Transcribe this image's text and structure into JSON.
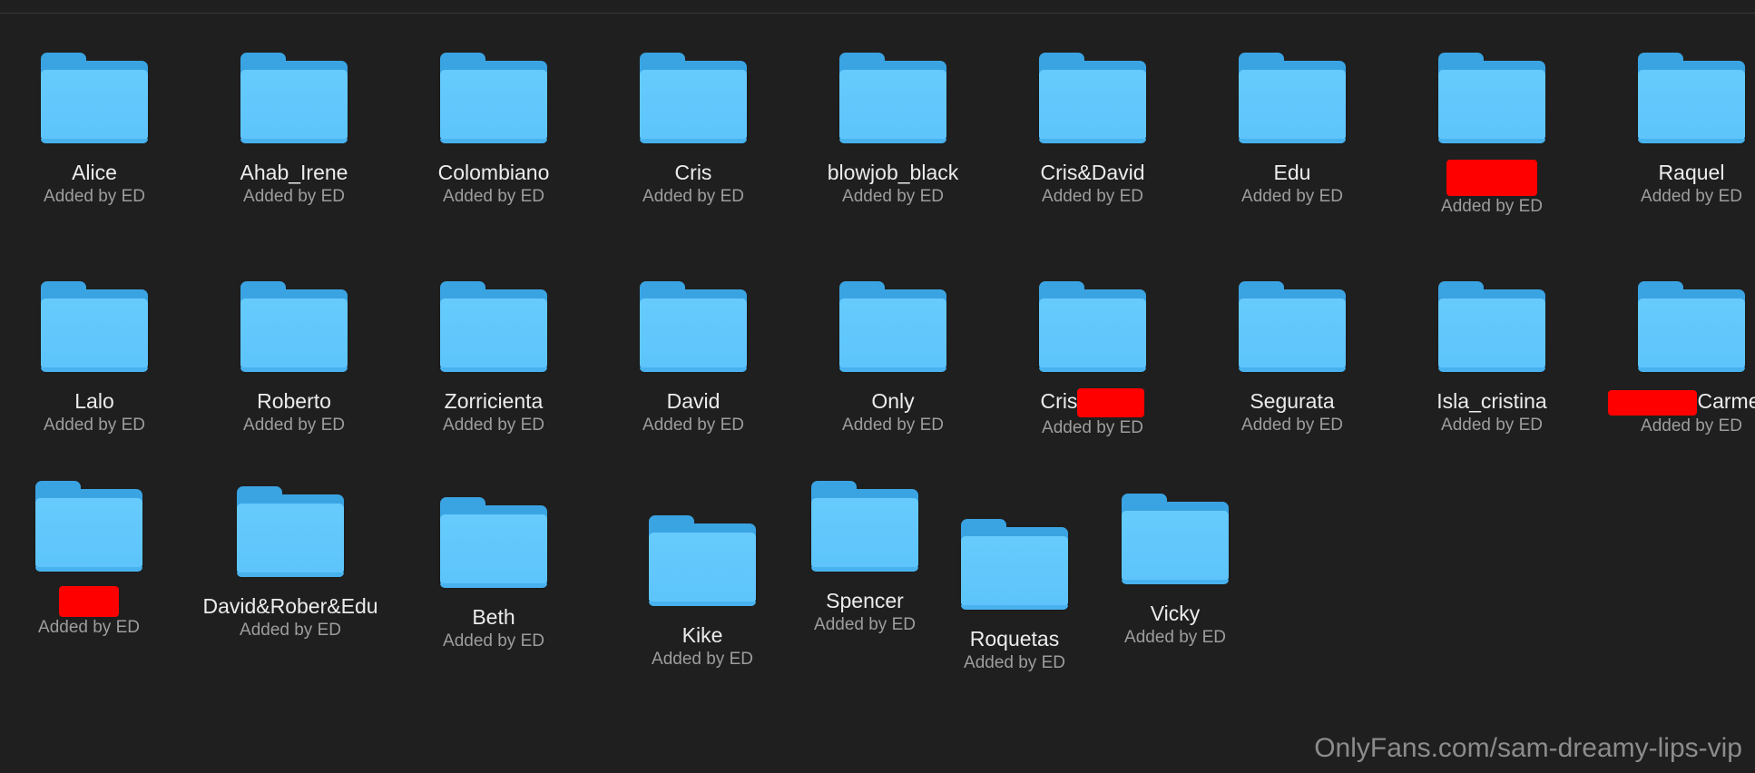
{
  "folders_row1": [
    {
      "name": "Alice",
      "sub": "Added by ED"
    },
    {
      "name": "Ahab_Irene",
      "sub": "Added by ED"
    },
    {
      "name": "Colombiano",
      "sub": "Added by ED"
    },
    {
      "name": "Cris",
      "sub": "Added by ED"
    },
    {
      "name": "blowjob_black",
      "sub": "Added by ED"
    },
    {
      "name": "Cris&David",
      "sub": "Added by ED"
    },
    {
      "name": "Edu",
      "sub": "Added by ED"
    },
    {
      "name": "",
      "sub": "Added by ED"
    },
    {
      "name": "Raquel",
      "sub": "Added by ED"
    }
  ],
  "folders_row2": [
    {
      "name": "Lalo",
      "sub": "Added by ED"
    },
    {
      "name": "Roberto",
      "sub": "Added by ED"
    },
    {
      "name": "Zorricienta",
      "sub": "Added by ED"
    },
    {
      "name": "David",
      "sub": "Added by ED"
    },
    {
      "name": "Only",
      "sub": "Added by ED"
    },
    {
      "name": "Cris",
      "sub": "Added by ED"
    },
    {
      "name": "Segurata",
      "sub": "Added by ED"
    },
    {
      "name": "Isla_cristina",
      "sub": "Added by ED"
    },
    {
      "name": "Carme",
      "sub": "Added by ED"
    }
  ],
  "folders_row3": [
    {
      "name": "",
      "sub": "Added by ED"
    },
    {
      "name": "David&Rober&Edu",
      "sub": "Added by ED"
    },
    {
      "name": "Beth",
      "sub": "Added by ED"
    },
    {
      "name": "Kike",
      "sub": "Added by ED"
    },
    {
      "name": "Spencer",
      "sub": "Added by ED"
    },
    {
      "name": "Roquetas",
      "sub": "Added by ED"
    },
    {
      "name": "Vicky",
      "sub": "Added by ED"
    }
  ],
  "watermark": "OnlyFans.com/sam-dreamy-lips-vip",
  "colors": {
    "background": "#1f1f1f",
    "folder_front": "#66cbfc",
    "folder_back": "#3aa4e3",
    "redaction": "#ff0000"
  }
}
